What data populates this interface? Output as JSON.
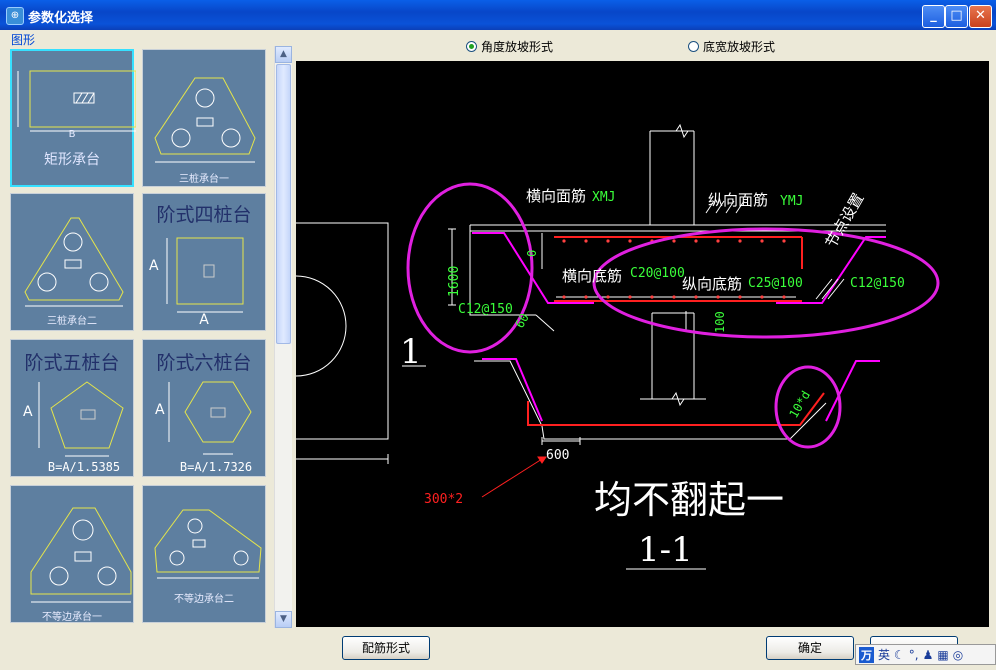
{
  "window": {
    "title": "参数化选择",
    "app_icon": "app-icon",
    "controls": [
      "minimize-icon",
      "maximize-icon",
      "close-icon"
    ],
    "control_glyphs": [
      "_",
      "□",
      "✕"
    ]
  },
  "left_panel": {
    "group_label": "图形",
    "thumbnails": [
      {
        "id": "rect",
        "caption": "矩形承台",
        "dim_label": "B",
        "selected": true
      },
      {
        "id": "three-pile-1",
        "caption": "三桩承台一",
        "selected": false
      },
      {
        "id": "three-pile-2",
        "caption": "三桩承台二",
        "selected": false
      },
      {
        "id": "step-four",
        "caption": "阶式四桩台",
        "dim_a_side": "A",
        "dim_a_bottom": "A",
        "selected": false
      },
      {
        "id": "step-five",
        "caption": "阶式五桩台",
        "dim_a_side": "A",
        "formula": "B=A/1.5385",
        "selected": false
      },
      {
        "id": "step-six",
        "caption": "阶式六桩台",
        "dim_a_side": "A",
        "formula": "B=A/1.7326",
        "selected": false
      },
      {
        "id": "uneq-1",
        "caption": "不等边承台一",
        "selected": false
      },
      {
        "id": "uneq-2",
        "caption": "不等边承台二",
        "selected": false
      }
    ]
  },
  "options": {
    "radio_angle": "角度放坡形式",
    "radio_base": "底宽放坡形式",
    "selected": "angle"
  },
  "drawing": {
    "labels": {
      "top_face_text": "横向面筋",
      "top_face_code": "XMJ",
      "long_face_text": "纵向面筋",
      "long_face_code": "YMJ",
      "slope_setting": "节点设置",
      "bottom_cross_text": "横向底筋",
      "bottom_cross_code": "C20@100",
      "bottom_long_text": "纵向底筋",
      "bottom_long_code": "C25@100",
      "side_right": "C12@150",
      "side_left": "C12@150",
      "height": "1600",
      "zero": "0",
      "angle": "60",
      "hundred": "100",
      "anchor": "10*d",
      "width_600": "600",
      "red_note": "300*2",
      "section_number": "1",
      "big_note": "均不翻起一",
      "section_title": "1-1"
    },
    "colors": {
      "line": "#ffffff",
      "rebar": "#ff2020",
      "slope": "#ff00ff",
      "annotation": "#3aff3a",
      "highlight": "#e020e0"
    }
  },
  "buttons": {
    "rebar_form": "配筋形式",
    "ok": "确定",
    "cancel": ""
  },
  "ime": {
    "logo": "万",
    "mode": "英"
  }
}
